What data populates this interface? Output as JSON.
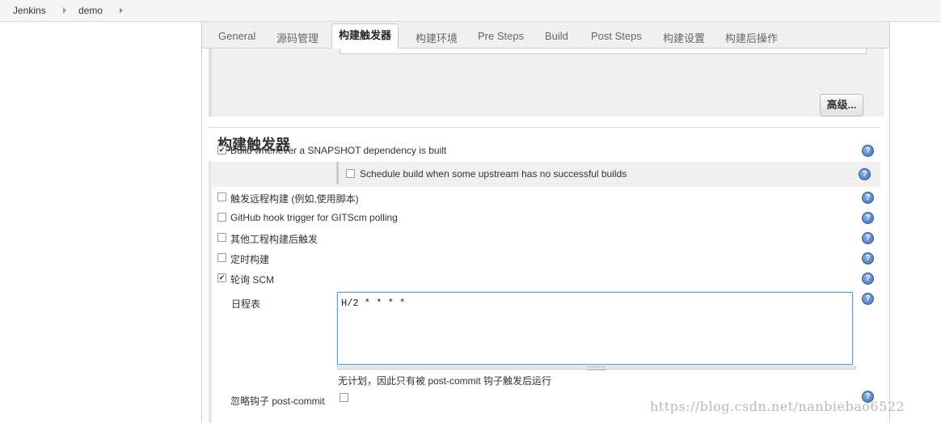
{
  "breadcrumb": {
    "items": [
      "Jenkins",
      "demo"
    ]
  },
  "tabs": [
    {
      "label": "General"
    },
    {
      "label": "源码管理"
    },
    {
      "label": "构建触发器"
    },
    {
      "label": "构建环境"
    },
    {
      "label": "Pre Steps"
    },
    {
      "label": "Build"
    },
    {
      "label": "Post Steps"
    },
    {
      "label": "构建设置"
    },
    {
      "label": "构建后操作"
    }
  ],
  "active_tab": "构建触发器",
  "advanced_button": "高级...",
  "section_title": "构建触发器",
  "triggers": [
    {
      "label": "Build whenever a SNAPSHOT dependency is built",
      "checked": true
    },
    {
      "label": "Schedule build when some upstream has no successful builds",
      "checked": false
    },
    {
      "label": "触发远程构建 (例如,使用脚本)",
      "checked": false
    },
    {
      "label": "GitHub hook trigger for GITScm polling",
      "checked": false
    },
    {
      "label": "其他工程构建后触发",
      "checked": false
    },
    {
      "label": "定时构建",
      "checked": false
    },
    {
      "label": "轮询 SCM",
      "checked": true
    }
  ],
  "check_mark": "✔",
  "help_glyph": "?",
  "schedule": {
    "label": "日程表",
    "value": "H/2 * * * *",
    "hint": "无计划，因此只有被 post-commit 钩子触发后运行"
  },
  "ignore_post_commit": {
    "label": "忽略钩子 post-commit",
    "checked": false
  },
  "watermark": "https://blog.csdn.net/nanbiebao6522",
  "colors": {
    "help_blue": "#3a6fb5",
    "focus_border": "#5b9bd5",
    "panel_bg": "#f0f0f0"
  }
}
